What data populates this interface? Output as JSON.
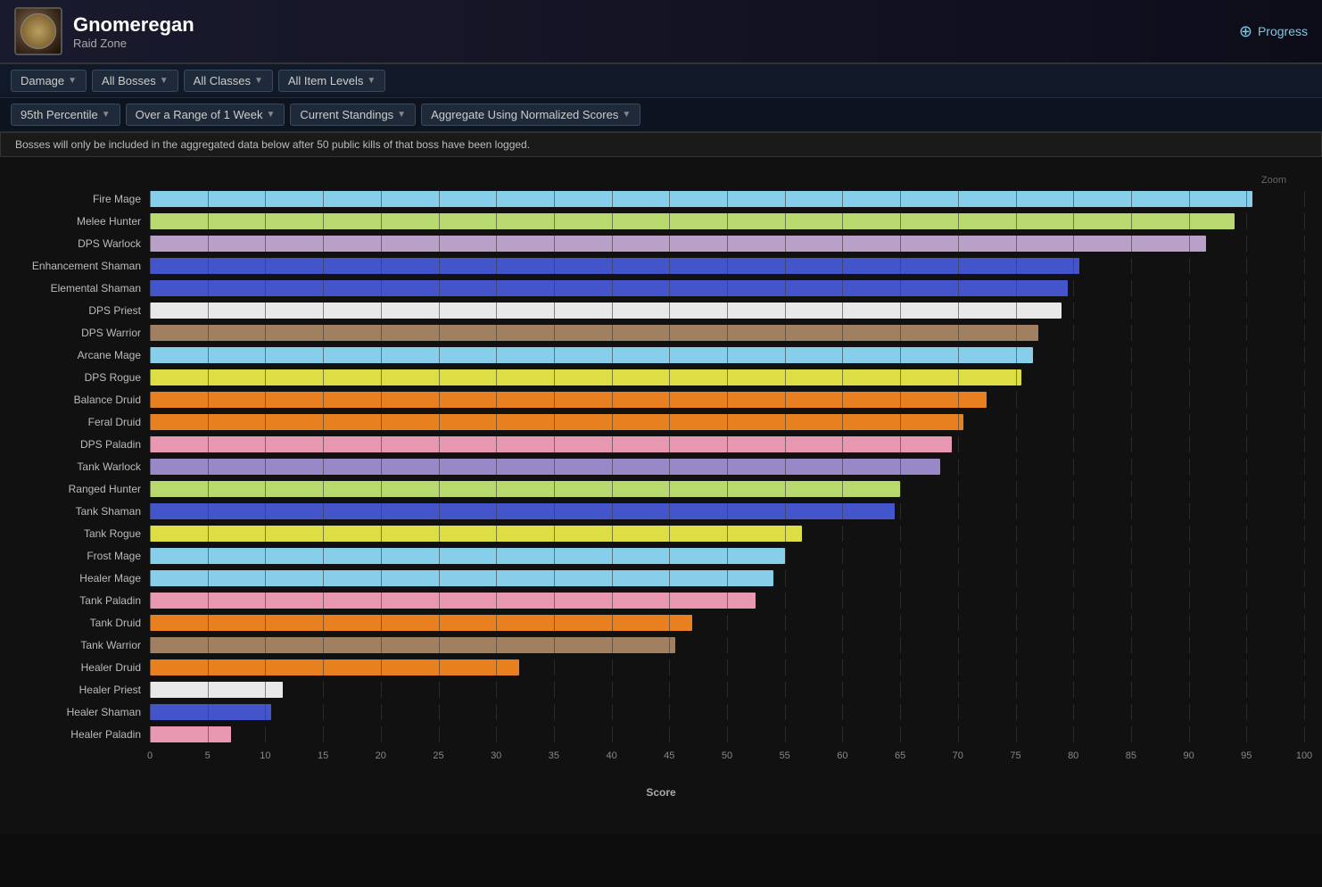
{
  "header": {
    "title": "Gnomeregan",
    "subtitle": "Raid Zone",
    "progress_label": "Progress",
    "icon_alt": "Gnomeregan icon"
  },
  "toolbar1": {
    "items": [
      {
        "label": "Damage",
        "id": "damage"
      },
      {
        "label": "All Bosses",
        "id": "all-bosses"
      },
      {
        "label": "All Classes",
        "id": "all-classes"
      },
      {
        "label": "All Item Levels",
        "id": "all-item-levels"
      }
    ]
  },
  "toolbar2": {
    "items": [
      {
        "label": "95th Percentile",
        "id": "percentile"
      },
      {
        "label": "Over a Range of 1 Week",
        "id": "time-range"
      },
      {
        "label": "Current Standings",
        "id": "standings"
      },
      {
        "label": "Aggregate Using Normalized Scores",
        "id": "aggregate"
      }
    ]
  },
  "info_bar": "Bosses will only be included in the aggregated data below after 50 public kills of that boss have been logged.",
  "zoom_label": "Zoom",
  "chart": {
    "x_axis_label": "Score",
    "x_ticks": [
      0,
      5,
      10,
      15,
      20,
      25,
      30,
      35,
      40,
      45,
      50,
      55,
      60,
      65,
      70,
      75,
      80,
      85,
      90,
      95,
      100
    ],
    "max_value": 100,
    "bars": [
      {
        "label": "Fire Mage",
        "value": 95.5,
        "color": "#87ceeb"
      },
      {
        "label": "Melee Hunter",
        "value": 94.0,
        "color": "#b8d96e"
      },
      {
        "label": "DPS Warlock",
        "value": 91.5,
        "color": "#b8a0c8"
      },
      {
        "label": "Enhancement Shaman",
        "value": 80.5,
        "color": "#4455cc"
      },
      {
        "label": "Elemental Shaman",
        "value": 79.5,
        "color": "#4455cc"
      },
      {
        "label": "DPS Priest",
        "value": 79.0,
        "color": "#e8e8e8"
      },
      {
        "label": "DPS Warrior",
        "value": 77.0,
        "color": "#a08060"
      },
      {
        "label": "Arcane Mage",
        "value": 76.5,
        "color": "#87ceeb"
      },
      {
        "label": "DPS Rogue",
        "value": 75.5,
        "color": "#dddd44"
      },
      {
        "label": "Balance Druid",
        "value": 72.5,
        "color": "#e88020"
      },
      {
        "label": "Feral Druid",
        "value": 70.5,
        "color": "#e88020"
      },
      {
        "label": "DPS Paladin",
        "value": 69.5,
        "color": "#e898b0"
      },
      {
        "label": "Tank Warlock",
        "value": 68.5,
        "color": "#9988c8"
      },
      {
        "label": "Ranged Hunter",
        "value": 65.0,
        "color": "#b8d96e"
      },
      {
        "label": "Tank Shaman",
        "value": 64.5,
        "color": "#4455cc"
      },
      {
        "label": "Tank Rogue",
        "value": 56.5,
        "color": "#dddd44"
      },
      {
        "label": "Frost Mage",
        "value": 55.0,
        "color": "#87ceeb"
      },
      {
        "label": "Healer Mage",
        "value": 54.0,
        "color": "#87ceeb"
      },
      {
        "label": "Tank Paladin",
        "value": 52.5,
        "color": "#e898b0"
      },
      {
        "label": "Tank Druid",
        "value": 47.0,
        "color": "#e88020"
      },
      {
        "label": "Tank Warrior",
        "value": 45.5,
        "color": "#a08060"
      },
      {
        "label": "Healer Druid",
        "value": 32.0,
        "color": "#e88020"
      },
      {
        "label": "Healer Priest",
        "value": 11.5,
        "color": "#e8e8e8"
      },
      {
        "label": "Healer Shaman",
        "value": 10.5,
        "color": "#4455cc"
      },
      {
        "label": "Healer Paladin",
        "value": 7.0,
        "color": "#e898b0"
      }
    ]
  }
}
